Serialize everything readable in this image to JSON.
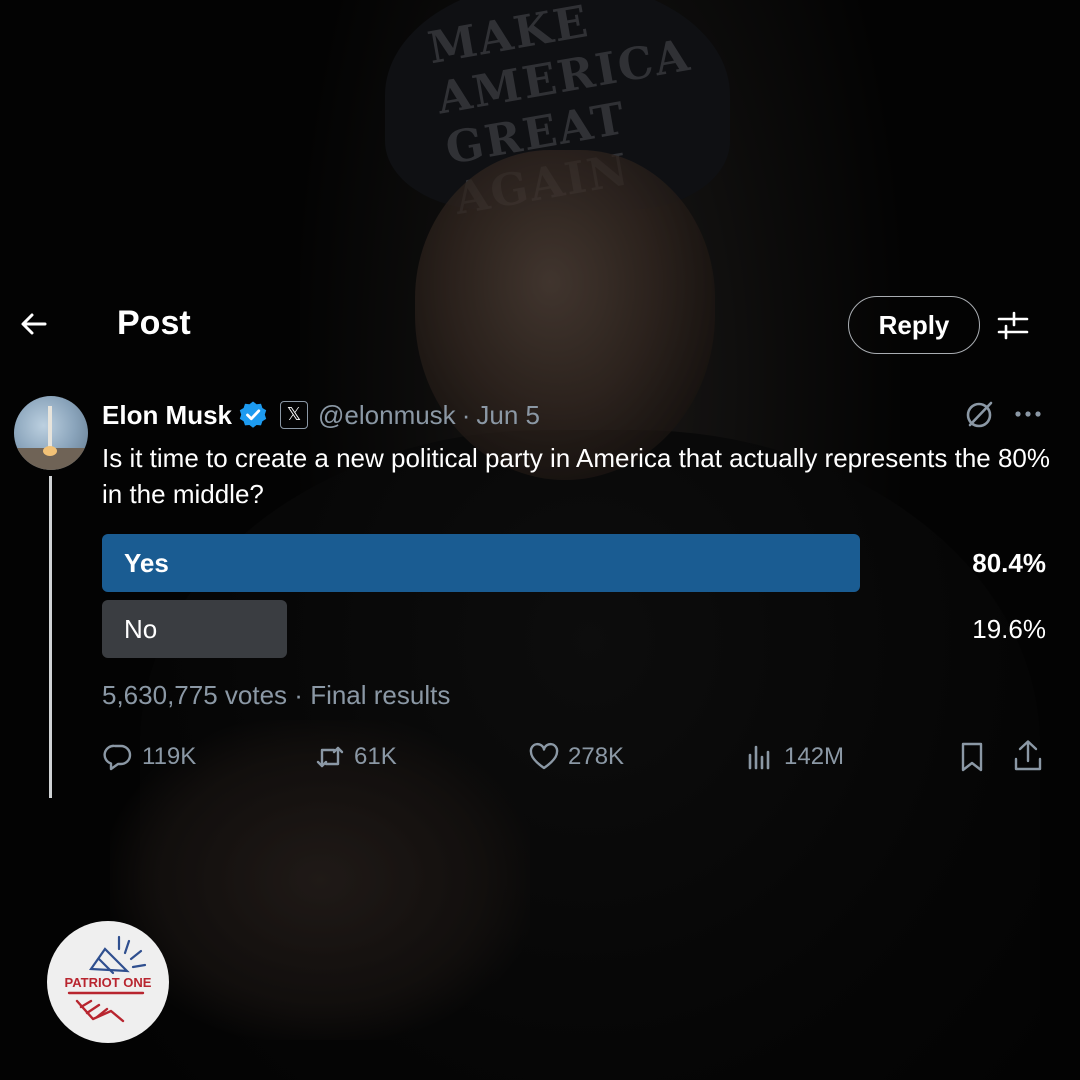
{
  "header": {
    "title": "Post",
    "reply_label": "Reply"
  },
  "post": {
    "author_name": "Elon Musk",
    "affiliation_badge": "𝕏",
    "handle": "@elonmusk",
    "separator": "·",
    "date": "Jun 5",
    "text": "Is it time to create a new political party in America that actually represents the 80% in the middle?"
  },
  "poll": {
    "options": [
      {
        "label": "Yes",
        "percent_text": "80.4%",
        "percent": 80.4,
        "leading": true
      },
      {
        "label": "No",
        "percent_text": "19.6%",
        "percent": 19.6,
        "leading": false
      }
    ],
    "votes": "5,630,775 votes",
    "separator": "·",
    "status": "Final results"
  },
  "actions": {
    "replies": "119K",
    "reposts": "61K",
    "likes": "278K",
    "views": "142M"
  },
  "watermark": {
    "text": "PATRIOT ONE"
  },
  "background_image": {
    "cap_text": "MAKE AMERICA GREAT AGAIN"
  },
  "colors": {
    "background": "#000000",
    "poll_leading": "#1a5c92",
    "poll_other": "#3a3d41",
    "verified": "#1d9bf0",
    "muted_text": "#8b98a5"
  },
  "icons": [
    "back-arrow-icon",
    "settings-sliders-icon",
    "verified-icon",
    "grok-icon",
    "more-icon",
    "reply-icon",
    "repost-icon",
    "like-icon",
    "views-icon",
    "bookmark-icon",
    "share-icon"
  ]
}
